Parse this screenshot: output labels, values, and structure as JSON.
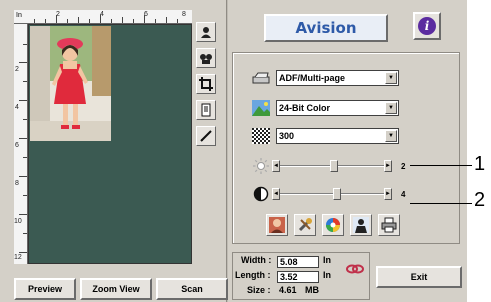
{
  "preview_pane": {
    "ruler_unit": "In",
    "ruler_top_ticks": [
      "2",
      "4",
      "6",
      "8"
    ],
    "ruler_left_ticks": [
      "2",
      "4",
      "6",
      "8",
      "10",
      "12"
    ],
    "tool_icons": [
      "auto-crop-icon",
      "magnify-icon",
      "crop-icon",
      "page-icon",
      "pen-icon"
    ]
  },
  "header": {
    "brand": "Avision",
    "info_symbol": "i"
  },
  "settings": {
    "scan_source": "ADF/Multi-page",
    "color_mode": "24-Bit Color",
    "resolution": "300",
    "brightness_value": "2",
    "contrast_value": "4",
    "brightness_level": 0.52,
    "contrast_level": 0.55
  },
  "callouts": [
    "1",
    "2"
  ],
  "dimensions": {
    "width_label": "Width :",
    "width_value": "5.08",
    "length_label": "Length :",
    "length_value": "3.52",
    "size_label": "Size :",
    "size_value": "4.61",
    "size_unit": "MB",
    "unit": "In"
  },
  "buttons": {
    "preview": "Preview",
    "zoom_view": "Zoom View",
    "scan": "Scan",
    "exit": "Exit"
  }
}
